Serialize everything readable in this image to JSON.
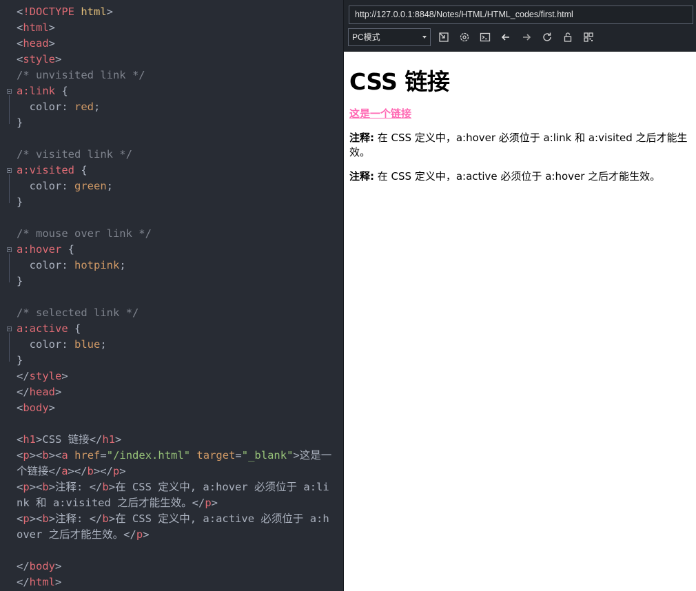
{
  "editor": {
    "lines": [
      [
        [
          "t-br",
          "<"
        ],
        [
          "t-doc",
          "!DOCTYPE"
        ],
        [
          "t-br",
          " "
        ],
        [
          "t-kw",
          "html"
        ],
        [
          "t-br",
          ">"
        ]
      ],
      [
        [
          "t-br",
          "<"
        ],
        [
          "t-tag",
          "html"
        ],
        [
          "t-br",
          ">"
        ]
      ],
      [
        [
          "t-br",
          "<"
        ],
        [
          "t-tag",
          "head"
        ],
        [
          "t-br",
          ">"
        ]
      ],
      [
        [
          "t-br",
          "<"
        ],
        [
          "t-tag",
          "style"
        ],
        [
          "t-br",
          ">"
        ]
      ],
      [
        [
          "t-cm",
          "/* unvisited link */"
        ]
      ],
      [
        [
          "t-sel",
          "a:link"
        ],
        [
          "t-br",
          " {"
        ]
      ],
      [
        [
          "t-prop",
          "  color"
        ],
        [
          "t-br",
          ": "
        ],
        [
          "t-val",
          "red"
        ],
        [
          "t-br",
          ";"
        ]
      ],
      [
        [
          "t-br",
          "}"
        ]
      ],
      [],
      [
        [
          "t-cm",
          "/* visited link */"
        ]
      ],
      [
        [
          "t-sel",
          "a:visited"
        ],
        [
          "t-br",
          " {"
        ]
      ],
      [
        [
          "t-prop",
          "  color"
        ],
        [
          "t-br",
          ": "
        ],
        [
          "t-val",
          "green"
        ],
        [
          "t-br",
          ";"
        ]
      ],
      [
        [
          "t-br",
          "}"
        ]
      ],
      [],
      [
        [
          "t-cm",
          "/* mouse over link */"
        ]
      ],
      [
        [
          "t-sel",
          "a:hover"
        ],
        [
          "t-br",
          " {"
        ]
      ],
      [
        [
          "t-prop",
          "  color"
        ],
        [
          "t-br",
          ": "
        ],
        [
          "t-val",
          "hotpink"
        ],
        [
          "t-br",
          ";"
        ]
      ],
      [
        [
          "t-br",
          "}"
        ]
      ],
      [],
      [
        [
          "t-cm",
          "/* selected link */"
        ]
      ],
      [
        [
          "t-sel",
          "a:active"
        ],
        [
          "t-br",
          " {"
        ]
      ],
      [
        [
          "t-prop",
          "  color"
        ],
        [
          "t-br",
          ": "
        ],
        [
          "t-val",
          "blue"
        ],
        [
          "t-br",
          ";"
        ]
      ],
      [
        [
          "t-br",
          "}"
        ]
      ],
      [
        [
          "t-br",
          "</"
        ],
        [
          "t-tag",
          "style"
        ],
        [
          "t-br",
          ">"
        ]
      ],
      [
        [
          "t-br",
          "</"
        ],
        [
          "t-tag",
          "head"
        ],
        [
          "t-br",
          ">"
        ]
      ],
      [
        [
          "t-br",
          "<"
        ],
        [
          "t-tag",
          "body"
        ],
        [
          "t-br",
          ">"
        ]
      ],
      [],
      [
        [
          "t-br",
          "<"
        ],
        [
          "t-tag",
          "h1"
        ],
        [
          "t-br",
          ">"
        ],
        [
          "t-txt",
          "CSS 链接"
        ],
        [
          "t-br",
          "</"
        ],
        [
          "t-tag",
          "h1"
        ],
        [
          "t-br",
          ">"
        ]
      ],
      [
        [
          "t-br",
          "<"
        ],
        [
          "t-tag",
          "p"
        ],
        [
          "t-br",
          "><"
        ],
        [
          "t-tag",
          "b"
        ],
        [
          "t-br",
          "><"
        ],
        [
          "t-tag",
          "a"
        ],
        [
          "t-br",
          " "
        ],
        [
          "t-attr",
          "href"
        ],
        [
          "t-br",
          "="
        ],
        [
          "t-str",
          "\"/index.html\""
        ],
        [
          "t-br",
          " "
        ],
        [
          "t-attr",
          "target"
        ],
        [
          "t-br",
          "="
        ],
        [
          "t-str",
          "\"_blank\""
        ],
        [
          "t-br",
          ">"
        ],
        [
          "t-txt",
          "这是一"
        ]
      ],
      [
        [
          "t-txt",
          "个链接"
        ],
        [
          "t-br",
          "</"
        ],
        [
          "t-tag",
          "a"
        ],
        [
          "t-br",
          "></"
        ],
        [
          "t-tag",
          "b"
        ],
        [
          "t-br",
          "></"
        ],
        [
          "t-tag",
          "p"
        ],
        [
          "t-br",
          ">"
        ]
      ],
      [
        [
          "t-br",
          "<"
        ],
        [
          "t-tag",
          "p"
        ],
        [
          "t-br",
          "><"
        ],
        [
          "t-tag",
          "b"
        ],
        [
          "t-br",
          ">"
        ],
        [
          "t-txt",
          "注释: "
        ],
        [
          "t-br",
          "</"
        ],
        [
          "t-tag",
          "b"
        ],
        [
          "t-br",
          ">"
        ],
        [
          "t-txt",
          "在 CSS 定义中, a:hover 必须位于 a:li"
        ]
      ],
      [
        [
          "t-txt",
          "nk 和 a:visited 之后才能生效。"
        ],
        [
          "t-br",
          "</"
        ],
        [
          "t-tag",
          "p"
        ],
        [
          "t-br",
          ">"
        ]
      ],
      [
        [
          "t-br",
          "<"
        ],
        [
          "t-tag",
          "p"
        ],
        [
          "t-br",
          "><"
        ],
        [
          "t-tag",
          "b"
        ],
        [
          "t-br",
          ">"
        ],
        [
          "t-txt",
          "注释: "
        ],
        [
          "t-br",
          "</"
        ],
        [
          "t-tag",
          "b"
        ],
        [
          "t-br",
          ">"
        ],
        [
          "t-txt",
          "在 CSS 定义中, a:active 必须位于 a:h"
        ]
      ],
      [
        [
          "t-txt",
          "over 之后才能生效。"
        ],
        [
          "t-br",
          "</"
        ],
        [
          "t-tag",
          "p"
        ],
        [
          "t-br",
          ">"
        ]
      ],
      [],
      [
        [
          "t-br",
          "</"
        ],
        [
          "t-tag",
          "body"
        ],
        [
          "t-br",
          ">"
        ]
      ],
      [
        [
          "t-br",
          "</"
        ],
        [
          "t-tag",
          "html"
        ],
        [
          "t-br",
          ">"
        ]
      ]
    ]
  },
  "browser": {
    "url": "http://127.0.0.1:8848/Notes/HTML/HTML_codes/first.html",
    "mode": "PC模式",
    "page": {
      "title": "CSS 链接",
      "link_text": "这是一个链接",
      "note_label": "注释:",
      "note1": " 在 CSS 定义中，a:hover 必须位于 a:link 和 a:visited 之后才能生效。",
      "note2": " 在 CSS 定义中，a:active 必须位于 a:hover 之后才能生效。"
    }
  },
  "colors": {
    "editor_bg": "#282c34",
    "toolbar_bg": "#21252b",
    "link_hover": "#ff69b4"
  },
  "icons": [
    "screenshot-icon",
    "settings-icon",
    "console-icon",
    "back-arrow-icon",
    "forward-arrow-icon",
    "reload-icon",
    "lock-icon",
    "qrcode-icon"
  ]
}
